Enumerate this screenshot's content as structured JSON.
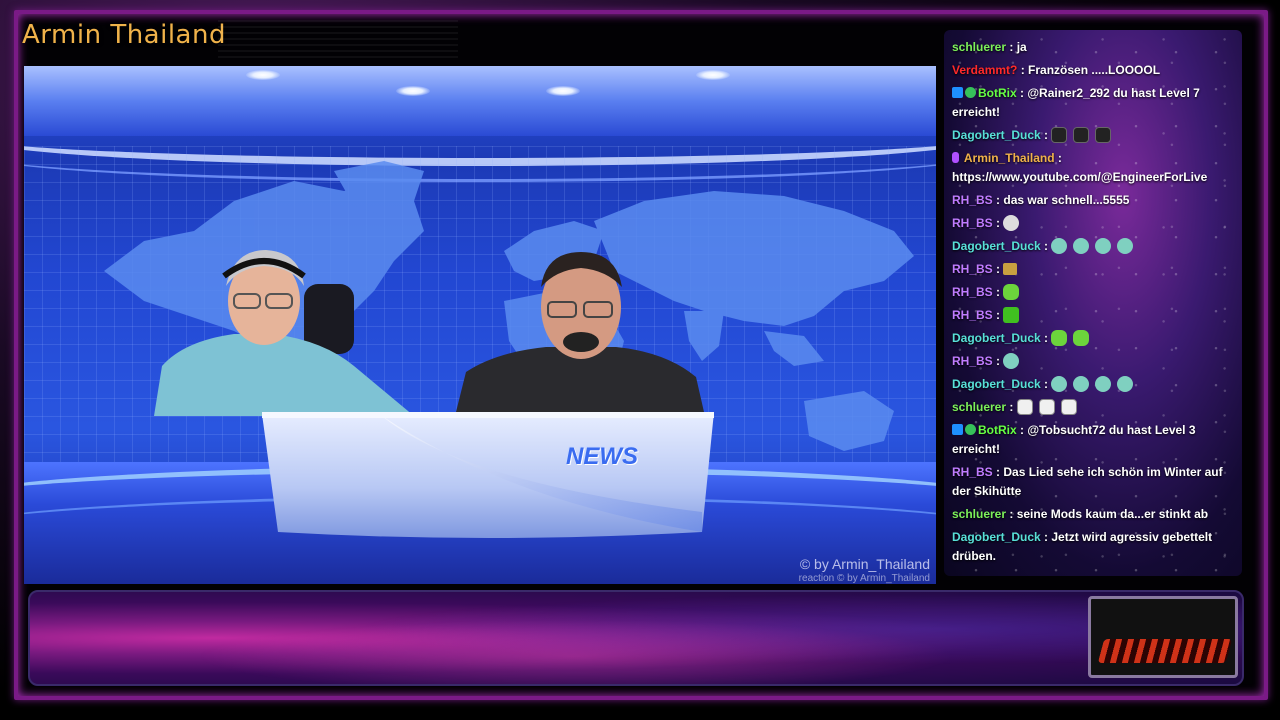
{
  "channel": {
    "title": "Armin Thailand"
  },
  "video": {
    "watermark": "© by Armin_Thailand",
    "watermark_small": "reaction  © by Armin_Thailand",
    "desk_sign": "NEWS"
  },
  "chat": {
    "messages": [
      {
        "user": "schluerer",
        "text": ": ja"
      },
      {
        "user": "Verdammt?",
        "text": ": Französen .....LOOOOL"
      },
      {
        "user": "BotRix",
        "text": ": @Rainer2_292 du hast Level 7 erreicht!"
      },
      {
        "user": "Dagobert_Duck",
        "text": ":"
      },
      {
        "user": "Armin_Thailand",
        "text": ":",
        "text2": "https://www.youtube.com/@EngineerForLive"
      },
      {
        "user": "RH_BS",
        "text": ": das war schnell...5555"
      },
      {
        "user": "RH_BS",
        "text": ":"
      },
      {
        "user": "Dagobert_Duck",
        "text": ":"
      },
      {
        "user": "RH_BS",
        "text": ":"
      },
      {
        "user": "RH_BS",
        "text": ":"
      },
      {
        "user": "RH_BS",
        "text": ":"
      },
      {
        "user": "Dagobert_Duck",
        "text": ":"
      },
      {
        "user": "RH_BS",
        "text": ":"
      },
      {
        "user": "Dagobert_Duck",
        "text": ":"
      },
      {
        "user": "schluerer",
        "text": ":"
      },
      {
        "user": "BotRix",
        "text": ": @Tobsucht72 du hast Level 3 erreicht!"
      },
      {
        "user": "RH_BS",
        "text": ": Das Lied sehe ich schön im Winter auf der Skihütte"
      },
      {
        "user": "schluerer",
        "text": ": seine Mods kaum da...er stinkt ab"
      },
      {
        "user": "Dagobert_Duck",
        "text": ": Jetzt wird agressiv gebettelt drüben."
      }
    ]
  },
  "colors": {
    "title": "#f0b24a",
    "frame_border": "#7a1a86",
    "user_schluerer": "#7cf05a",
    "user_verdammt": "#ff2a2a",
    "user_botrix": "#66ff44",
    "user_dagobert": "#58e0d8",
    "user_armin": "#f0b24a",
    "user_rhbs": "#c07cff"
  }
}
